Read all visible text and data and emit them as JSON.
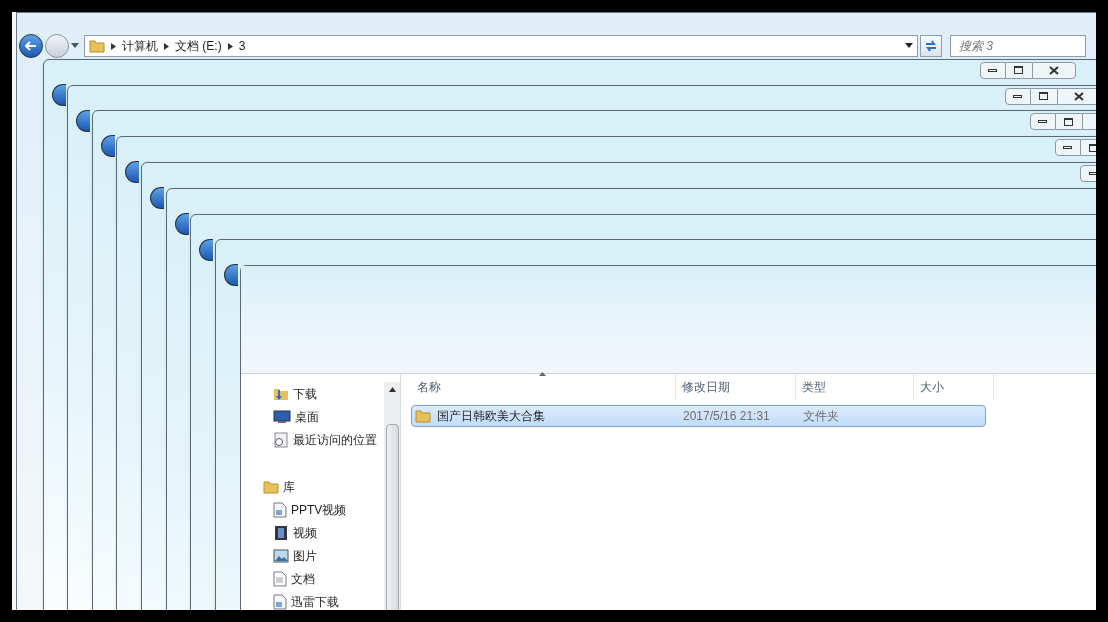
{
  "address_bar": {
    "breadcrumbs": [
      "计算机",
      "文档 (E:)",
      "3"
    ]
  },
  "search": {
    "placeholder": "搜索 3"
  },
  "nav_pane": {
    "favorites": [
      {
        "label": "下载",
        "kind": "download"
      },
      {
        "label": "桌面",
        "kind": "desktop"
      },
      {
        "label": "最近访问的位置",
        "kind": "recent"
      }
    ],
    "library": {
      "label": "库",
      "children": [
        {
          "label": "PPTV视频",
          "kind": "file"
        },
        {
          "label": "视频",
          "kind": "video"
        },
        {
          "label": "图片",
          "kind": "picture"
        },
        {
          "label": "文档",
          "kind": "document"
        },
        {
          "label": "迅雷下载",
          "kind": "file"
        }
      ]
    }
  },
  "file_list": {
    "columns": [
      "名称",
      "修改日期",
      "类型",
      "大小"
    ],
    "rows": [
      {
        "name": "国产日韩欧美大合集",
        "modified": "2017/5/16 21:31",
        "type": "文件夹",
        "selected": true
      }
    ]
  }
}
